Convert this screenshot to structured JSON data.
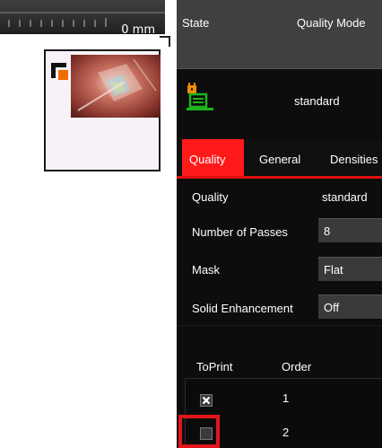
{
  "ruler": {
    "label": "0 mm"
  },
  "header": {
    "state_label": "State",
    "quality_mode_label": "Quality Mode"
  },
  "status": {
    "icon": "locked-printer-icon",
    "value": "standard"
  },
  "tabs": [
    {
      "label": "Quality",
      "active": true
    },
    {
      "label": "General",
      "active": false
    },
    {
      "label": "Densities",
      "active": false
    }
  ],
  "fields": {
    "quality": {
      "label": "Quality",
      "value": "standard"
    },
    "passes": {
      "label": "Number of Passes",
      "value": "8"
    },
    "mask": {
      "label": "Mask",
      "value": "Flat"
    },
    "solid": {
      "label": "Solid Enhancement",
      "value": "Off"
    }
  },
  "table": {
    "headers": {
      "toprint": "ToPrint",
      "order": "Order"
    },
    "rows": [
      {
        "checked": true,
        "order": "1"
      },
      {
        "checked": false,
        "order": "2"
      }
    ]
  },
  "colors": {
    "accent": "#ff1a1a",
    "highlight": "#e3151a",
    "icon_green": "#1db31d",
    "icon_lock": "#f28c00"
  }
}
